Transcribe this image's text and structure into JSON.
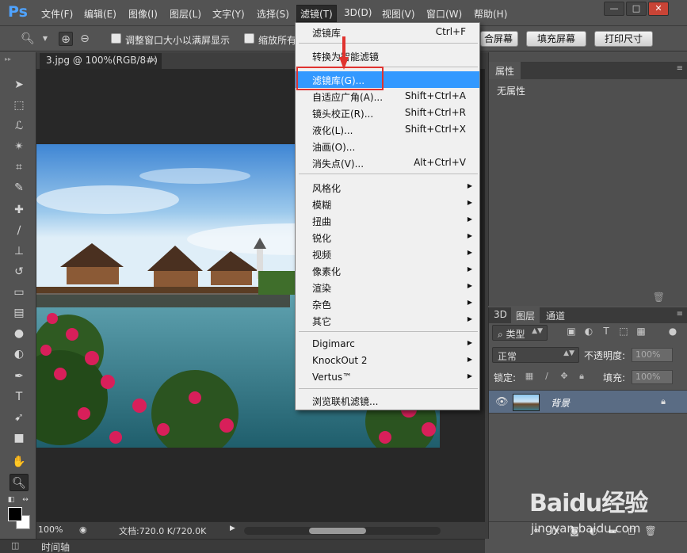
{
  "app": {
    "logo": "Ps"
  },
  "menubar": {
    "items": [
      {
        "label": "文件(F)"
      },
      {
        "label": "编辑(E)"
      },
      {
        "label": "图像(I)"
      },
      {
        "label": "图层(L)"
      },
      {
        "label": "文字(Y)"
      },
      {
        "label": "选择(S)"
      },
      {
        "label": "滤镜(T)"
      },
      {
        "label": "3D(D)"
      },
      {
        "label": "视图(V)"
      },
      {
        "label": "窗口(W)"
      },
      {
        "label": "帮助(H)"
      }
    ],
    "window_controls": {
      "minimize": "—",
      "restore": "□",
      "close": "✕"
    }
  },
  "options_bar": {
    "zoom_tool_icon": "zoom-icon",
    "chk1_label": "调整窗口大小以满屏显示",
    "chk2_label": "缩放所有",
    "btn_fill_screen_partial": "合屏幕",
    "btn_fill_screen": "填充屏幕",
    "btn_print_size": "打印尺寸"
  },
  "document": {
    "tab_title": "3.jpg @ 100%(RGB/8#)",
    "tab_close": "×",
    "zoom": "100%",
    "doc_info": "文档:720.0 K/720.0K"
  },
  "filter_menu": {
    "items": [
      {
        "label": "滤镜库",
        "shortcut": "Ctrl+F"
      },
      {
        "label": "转换为智能滤镜"
      },
      {
        "label": "滤镜库(G)...",
        "highlighted": true
      },
      {
        "label": "自适应广角(A)...",
        "shortcut": "Shift+Ctrl+A"
      },
      {
        "label": "镜头校正(R)...",
        "shortcut": "Shift+Ctrl+R"
      },
      {
        "label": "液化(L)...",
        "shortcut": "Shift+Ctrl+X"
      },
      {
        "label": "油画(O)..."
      },
      {
        "label": "消失点(V)...",
        "shortcut": "Alt+Ctrl+V"
      },
      {
        "label": "风格化"
      },
      {
        "label": "模糊"
      },
      {
        "label": "扭曲"
      },
      {
        "label": "锐化"
      },
      {
        "label": "视频"
      },
      {
        "label": "像素化"
      },
      {
        "label": "渲染"
      },
      {
        "label": "杂色"
      },
      {
        "label": "其它"
      },
      {
        "label": "Digimarc"
      },
      {
        "label": "KnockOut 2"
      },
      {
        "label": "Vertus™"
      },
      {
        "label": "浏览联机滤镜..."
      }
    ],
    "submenu_arrow": "▶"
  },
  "properties_panel": {
    "tab": "属性",
    "body": "无属性"
  },
  "layers_panel": {
    "tabs": [
      "3D",
      "图层",
      "通道"
    ],
    "filter_kind": "类型",
    "blend_mode": "正常",
    "opacity_label": "不透明度:",
    "opacity_value": "100%",
    "lock_label": "锁定:",
    "fill_label": "填充:",
    "fill_value": "100%",
    "layer_name": "背景"
  },
  "timeline": {
    "label": "时间轴"
  },
  "watermark": {
    "brand": "Baidu经验",
    "url": "jingyan.baidu.com"
  },
  "colors": {
    "menu_highlight": "#3399ff",
    "annotation_red": "#e0332f",
    "layer_selected": "#5a6c84"
  }
}
